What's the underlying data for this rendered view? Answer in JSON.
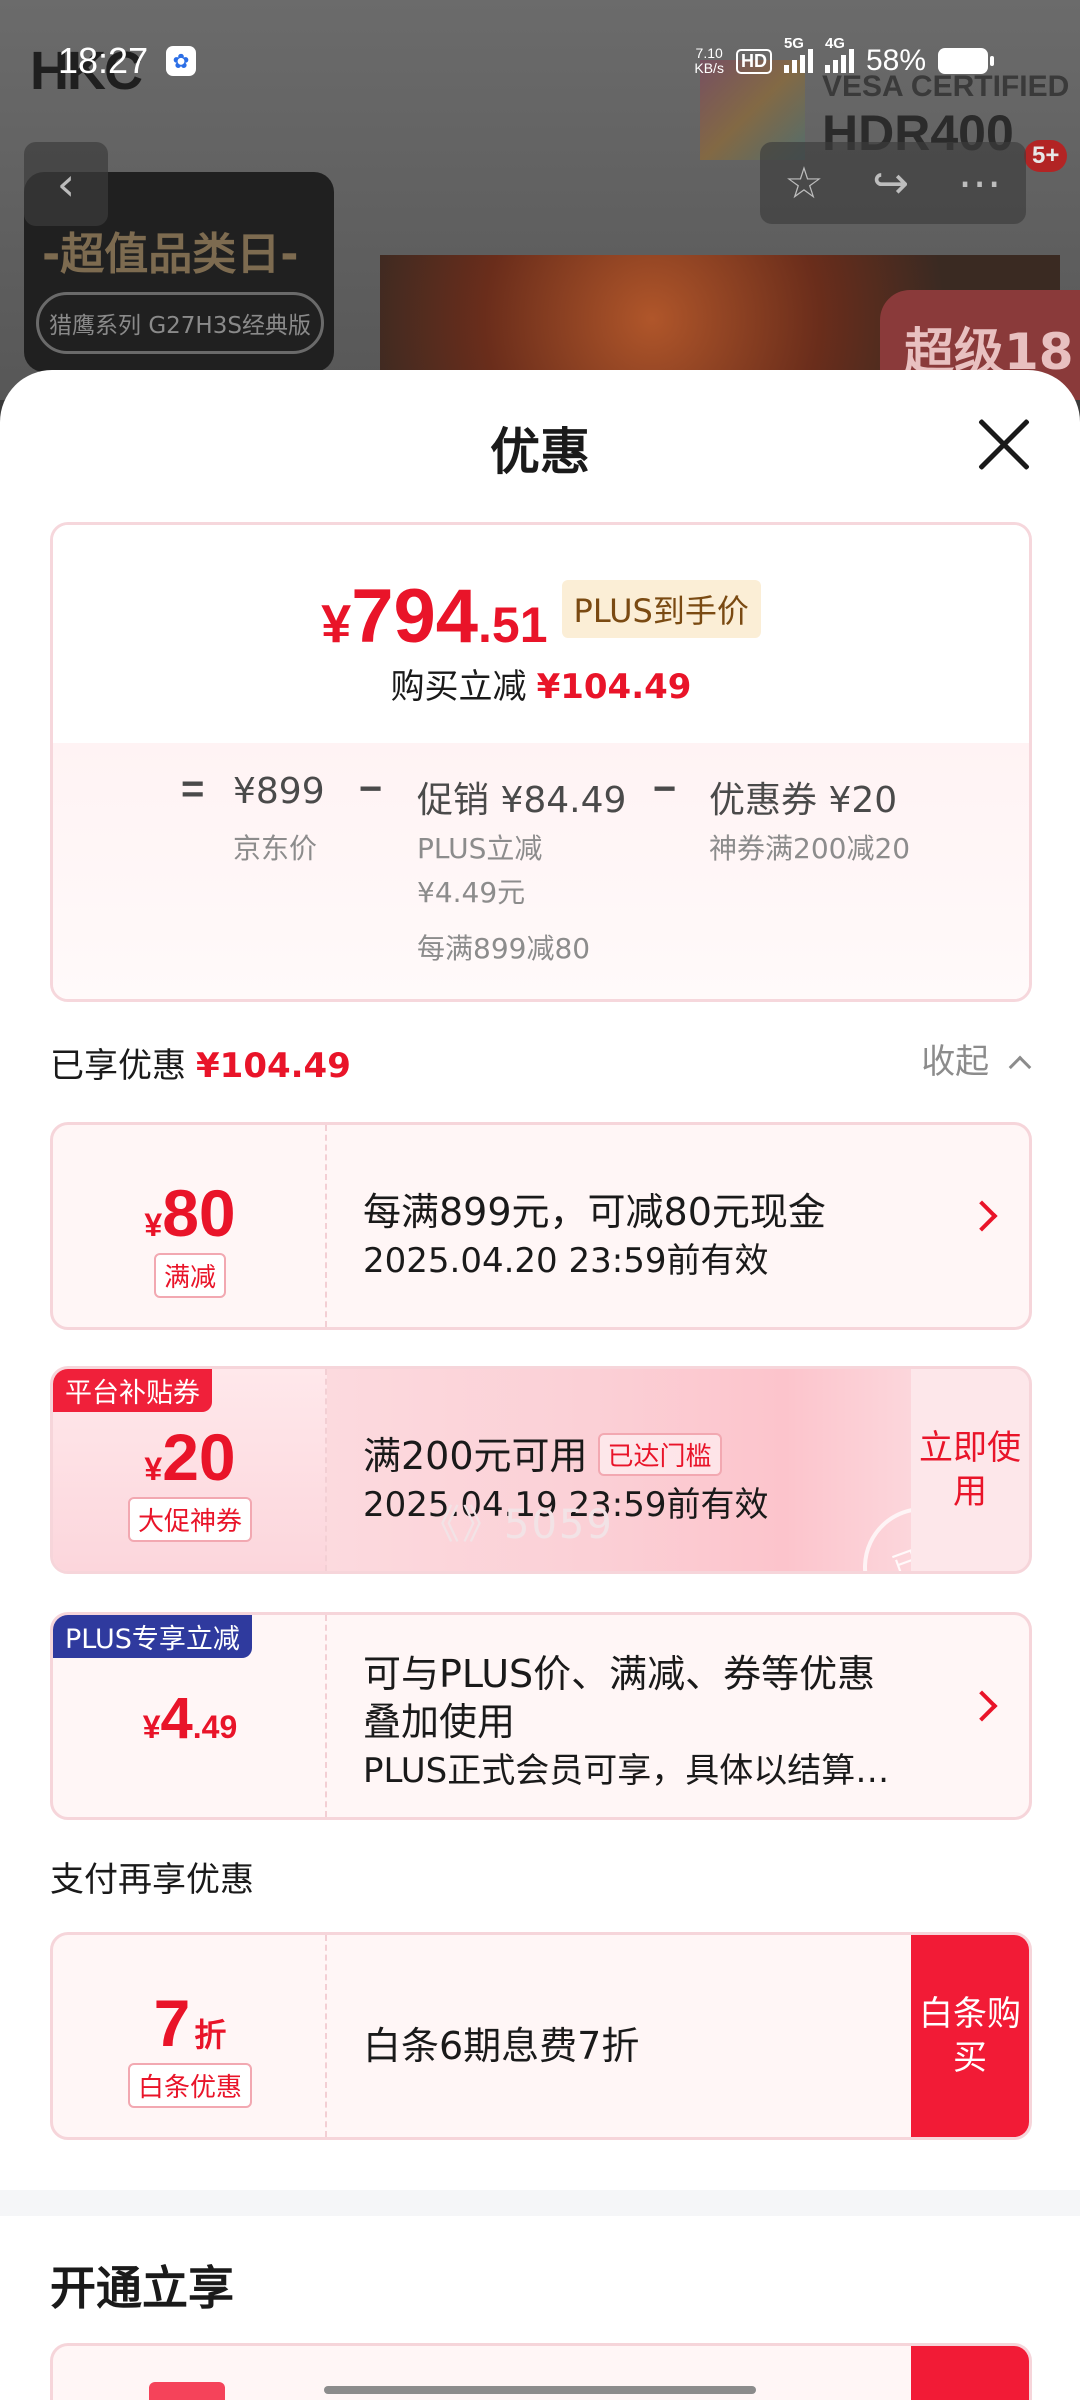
{
  "status_bar": {
    "time": "18:27",
    "net_speed_value": "7.10",
    "net_speed_unit": "KB/s",
    "hd_label": "HD",
    "sim1_label": "5G",
    "sim2_label": "4G",
    "battery": "58%"
  },
  "background": {
    "logo": "HKC",
    "vesa_line1": "VESA CERTIFIED",
    "vesa_line2": "HDR400",
    "badge": "5+",
    "promo_title": "-超值品类日-",
    "promo_pill": "猎鹰系列 G27H3S经典版",
    "banner_text": "超级18"
  },
  "sheet": {
    "title": "优惠",
    "summary": {
      "currency": "¥",
      "price_int": "794",
      "price_dec": ".51",
      "plus_tag": "PLUS到手价",
      "save_label": "购买立减",
      "save_amount": "¥104.49",
      "calc": {
        "eq": "=",
        "jd_price": "¥899",
        "jd_price_label": "京东价",
        "minus1": "−",
        "promo": "促销 ¥84.49",
        "promo_line1": "PLUS立减",
        "promo_line2": "¥4.49元",
        "promo_line3": "每满899减80",
        "minus2": "−",
        "coupon": "优惠券 ¥20",
        "coupon_label": "神券满200减20"
      }
    },
    "enjoyed_label": "已享优惠",
    "enjoyed_amount": "¥104.49",
    "collapse_label": "收起",
    "coupons": [
      {
        "yen": "¥",
        "amount": "80",
        "tag": "满减",
        "line1": "每满899元，可减80元现金",
        "line2": "2025.04.20 23:59前有效"
      },
      {
        "corner": "平台补贴券",
        "yen": "¥",
        "amount": "20",
        "tag": "大促神券",
        "line1": "满200元可用",
        "threshold": "已达门槛",
        "line2": "2025.04.19 23:59前有效",
        "cta": "立即使用",
        "stamp": "已领"
      },
      {
        "corner": "PLUS专享立减",
        "yen": "¥",
        "amount": "4",
        "decimal": ".49",
        "line1": "可与PLUS价、满减、券等优惠",
        "line2": "叠加使用",
        "line3": "PLUS正式会员可享，具体以结算…"
      }
    ],
    "watermark": "《》5059",
    "pay_section_label": "支付再享优惠",
    "pay_card": {
      "amount": "7",
      "unit": "折",
      "tag": "白条优惠",
      "text": "白条6期息费7折",
      "cta": "白条购买"
    },
    "open_title": "开通立享"
  },
  "colors": {
    "accent_red": "#e91429",
    "plus_blue": "#2f3a9e",
    "cta_red": "#f21b36"
  }
}
